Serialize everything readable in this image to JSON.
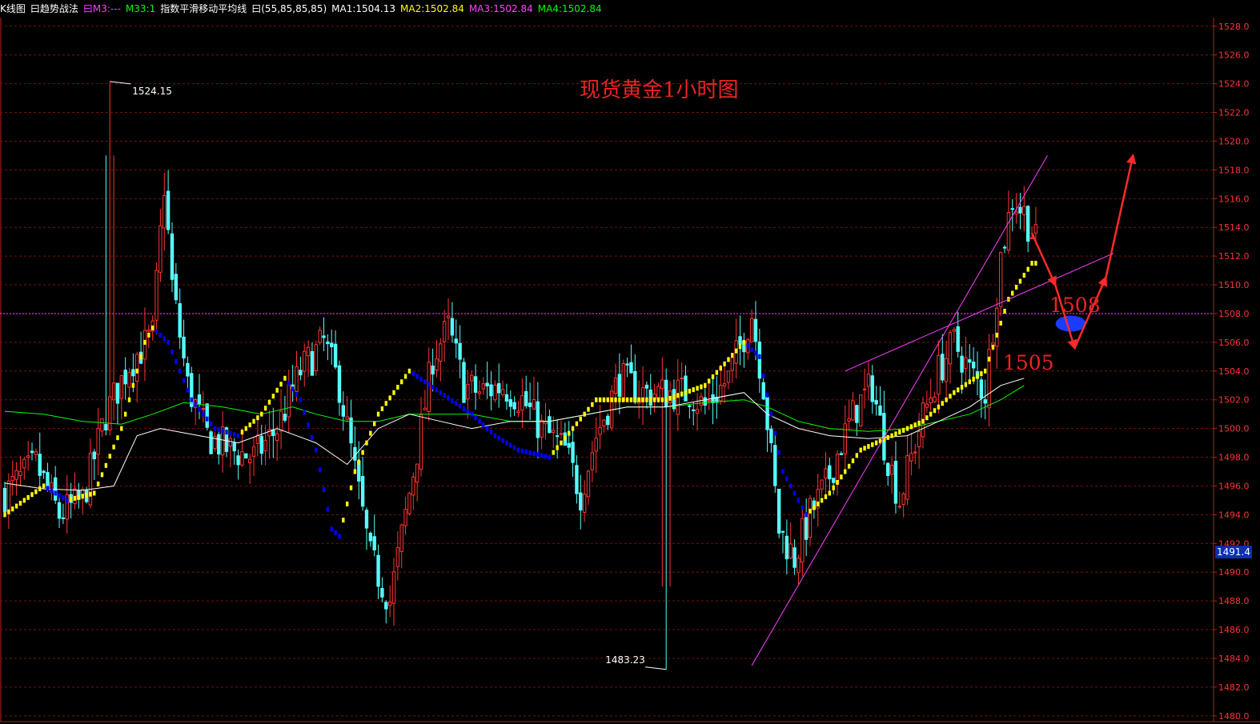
{
  "header": {
    "items": [
      {
        "text": "K线图",
        "color": "#ffffff"
      },
      {
        "text": "曰趋势战法",
        "color": "#ffffff"
      },
      {
        "text": "曰M3:---",
        "color": "#ff40ff"
      },
      {
        "text": "M33:1",
        "color": "#00ff00"
      },
      {
        "text": "指数平滑移动平均线",
        "color": "#ffffff"
      },
      {
        "text": "曰(55,85,85,85)",
        "color": "#ffffff"
      },
      {
        "text": "MA1:1504.13",
        "color": "#ffffff"
      },
      {
        "text": "MA2:1502.84",
        "color": "#ffff00"
      },
      {
        "text": "MA3:1502.84",
        "color": "#ff40ff"
      },
      {
        "text": "MA4:1502.84",
        "color": "#00ff00"
      }
    ]
  },
  "chart_data": {
    "type": "candlestick",
    "title": "现货黄金1小时图",
    "ylim": [
      1479.6,
      1528.6
    ],
    "y_ticks": [
      1480,
      1482,
      1484,
      1486,
      1488,
      1490,
      1492,
      1494,
      1496,
      1498,
      1500,
      1502,
      1504,
      1506,
      1508,
      1510,
      1512,
      1514,
      1516,
      1518,
      1520,
      1522,
      1524,
      1526,
      1528
    ],
    "y_tick_labels": [
      "1480.0",
      "1482.0",
      "1484.0",
      "1486.0",
      "1488.0",
      "1490.0",
      "1492.0",
      "1494.0",
      "1496.0",
      "1498.0",
      "1500.0",
      "1502.0",
      "1504.0",
      "1506.0",
      "1508.0",
      "1510.0",
      "1512.0",
      "1514.0",
      "1516.0",
      "1518.0",
      "1520.0",
      "1522.0",
      "1524.0",
      "1526.0",
      "1528.0"
    ],
    "current_price": "1491.4",
    "horizontal_line": 1508.0,
    "high_label": {
      "text": "1524.15",
      "value": 1524.15
    },
    "low_label": {
      "text": "1483.23",
      "value": 1483.23
    },
    "annotations": [
      {
        "text": "1508",
        "value": 1508.0
      },
      {
        "text": "1505",
        "value": 1505.0
      }
    ],
    "colors": {
      "up": "#ff3333",
      "down": "#54ffff",
      "trend_up": "#ffff00",
      "trend_down": "#0000ff",
      "ma_white": "#ffffff",
      "ma_green": "#00ff00",
      "line_magenta": "#ff40ff",
      "arrow_red": "#ff2a2a",
      "ellipse_blue": "#1a3cff",
      "axis_label": "#ff3333"
    },
    "n_candles": 230,
    "keypoints": [
      [
        0,
        1495.5
      ],
      [
        8,
        1497.5
      ],
      [
        14,
        1494
      ],
      [
        20,
        1495
      ],
      [
        26,
        1501
      ],
      [
        32,
        1504.5
      ],
      [
        38,
        1506.5
      ],
      [
        41,
        1517
      ],
      [
        43,
        1510
      ],
      [
        47,
        1503
      ],
      [
        52,
        1499.5
      ],
      [
        58,
        1498.5
      ],
      [
        64,
        1498
      ],
      [
        70,
        1500
      ],
      [
        76,
        1504
      ],
      [
        82,
        1506
      ],
      [
        86,
        1503
      ],
      [
        90,
        1497
      ],
      [
        94,
        1491
      ],
      [
        99,
        1488
      ],
      [
        103,
        1494
      ],
      [
        107,
        1500
      ],
      [
        110,
        1505
      ],
      [
        114,
        1507
      ],
      [
        118,
        1503
      ],
      [
        122,
        1502.5
      ],
      [
        128,
        1503
      ],
      [
        133,
        1502
      ],
      [
        138,
        1500
      ],
      [
        144,
        1498.5
      ],
      [
        148,
        1495.5
      ],
      [
        152,
        1499.5
      ],
      [
        158,
        1503.5
      ],
      [
        164,
        1502.5
      ],
      [
        170,
        1502.5
      ],
      [
        176,
        1502.5
      ],
      [
        180,
        1501.5
      ],
      [
        186,
        1503.5
      ],
      [
        192,
        1508
      ],
      [
        195,
        1503
      ],
      [
        199,
        1493
      ],
      [
        203,
        1491
      ],
      [
        207,
        1494
      ],
      [
        211,
        1496
      ],
      [
        215,
        1499
      ],
      [
        219,
        1501.5
      ],
      [
        223,
        1503
      ],
      [
        226,
        1499
      ],
      [
        230,
        1495
      ],
      [
        235,
        1500
      ],
      [
        240,
        1504
      ],
      [
        244,
        1506
      ],
      [
        248,
        1504
      ],
      [
        252,
        1502.5
      ],
      [
        256,
        1512
      ],
      [
        259,
        1516
      ],
      [
        262,
        1515
      ],
      [
        265,
        1513
      ]
    ],
    "trend_series": [
      [
        0,
        1494
      ],
      [
        10,
        1496
      ],
      [
        16,
        1495
      ],
      [
        23,
        1495.5
      ],
      [
        30,
        1500
      ],
      [
        36,
        1506
      ],
      [
        38,
        1507
      ],
      [
        42,
        1506
      ],
      [
        48,
        1502
      ],
      [
        54,
        1500
      ],
      [
        60,
        1499.5
      ],
      [
        66,
        1501
      ],
      [
        72,
        1503.5
      ],
      [
        76,
        1502
      ],
      [
        80,
        1498.5
      ],
      [
        84,
        1493
      ],
      [
        86,
        1492.5
      ],
      [
        90,
        1497
      ],
      [
        96,
        1501
      ],
      [
        104,
        1504
      ],
      [
        112,
        1502.5
      ],
      [
        120,
        1501
      ],
      [
        126,
        1499.5
      ],
      [
        132,
        1498.5
      ],
      [
        140,
        1498
      ],
      [
        146,
        1500
      ],
      [
        152,
        1502
      ],
      [
        160,
        1502
      ],
      [
        170,
        1502
      ],
      [
        180,
        1503
      ],
      [
        190,
        1506
      ],
      [
        194,
        1505
      ],
      [
        200,
        1497
      ],
      [
        206,
        1494
      ],
      [
        212,
        1495.5
      ],
      [
        220,
        1498.5
      ],
      [
        228,
        1499.5
      ],
      [
        236,
        1500.5
      ],
      [
        244,
        1502.5
      ],
      [
        252,
        1504
      ],
      [
        258,
        1509
      ],
      [
        264,
        1511.5
      ]
    ],
    "ma_white": [
      [
        0,
        1496.2
      ],
      [
        10,
        1495.8
      ],
      [
        20,
        1495.7
      ],
      [
        28,
        1496
      ],
      [
        34,
        1499.5
      ],
      [
        40,
        1500
      ],
      [
        50,
        1499.5
      ],
      [
        60,
        1499
      ],
      [
        70,
        1500
      ],
      [
        80,
        1499
      ],
      [
        88,
        1497.5
      ],
      [
        96,
        1500
      ],
      [
        104,
        1501
      ],
      [
        112,
        1500.5
      ],
      [
        120,
        1500
      ],
      [
        130,
        1500.5
      ],
      [
        140,
        1500.5
      ],
      [
        150,
        1501
      ],
      [
        160,
        1501.5
      ],
      [
        170,
        1501.5
      ],
      [
        180,
        1502
      ],
      [
        190,
        1502.5
      ],
      [
        196,
        1501
      ],
      [
        204,
        1500
      ],
      [
        212,
        1499.5
      ],
      [
        222,
        1499.3
      ],
      [
        232,
        1499.5
      ],
      [
        240,
        1500.5
      ],
      [
        248,
        1501.5
      ],
      [
        256,
        1503
      ],
      [
        262,
        1503.5
      ]
    ],
    "ma_green": [
      [
        0,
        1501.2
      ],
      [
        10,
        1501
      ],
      [
        20,
        1500.5
      ],
      [
        30,
        1500.3
      ],
      [
        38,
        1501
      ],
      [
        46,
        1501.8
      ],
      [
        56,
        1501.5
      ],
      [
        66,
        1501
      ],
      [
        74,
        1501.5
      ],
      [
        80,
        1501
      ],
      [
        88,
        1500.5
      ],
      [
        96,
        1500.5
      ],
      [
        104,
        1501
      ],
      [
        112,
        1501
      ],
      [
        120,
        1501
      ],
      [
        130,
        1500.5
      ],
      [
        140,
        1500.5
      ],
      [
        150,
        1501
      ],
      [
        160,
        1501.5
      ],
      [
        170,
        1501.5
      ],
      [
        180,
        1501.8
      ],
      [
        190,
        1502
      ],
      [
        196,
        1501.5
      ],
      [
        204,
        1500.5
      ],
      [
        212,
        1500
      ],
      [
        222,
        1499.8
      ],
      [
        232,
        1500
      ],
      [
        240,
        1500.5
      ],
      [
        248,
        1501
      ],
      [
        256,
        1502
      ],
      [
        262,
        1503
      ]
    ],
    "up_trendline": [
      [
        192,
        1483.5
      ],
      [
        268,
        1519
      ]
    ],
    "channel_line": [
      [
        216,
        1504
      ],
      [
        285,
        1512.2
      ]
    ],
    "arrows": [
      [
        [
          264,
          1513.6
        ],
        [
          270,
          1510
        ]
      ],
      [
        [
          270,
          1510
        ],
        [
          275,
          1505.6
        ]
      ],
      [
        [
          275,
          1505.6
        ],
        [
          283,
          1510.5
        ]
      ],
      [
        [
          283,
          1510.5
        ],
        [
          290,
          1519
        ]
      ]
    ],
    "ellipse": {
      "x": 274,
      "y": 1507.3
    }
  }
}
